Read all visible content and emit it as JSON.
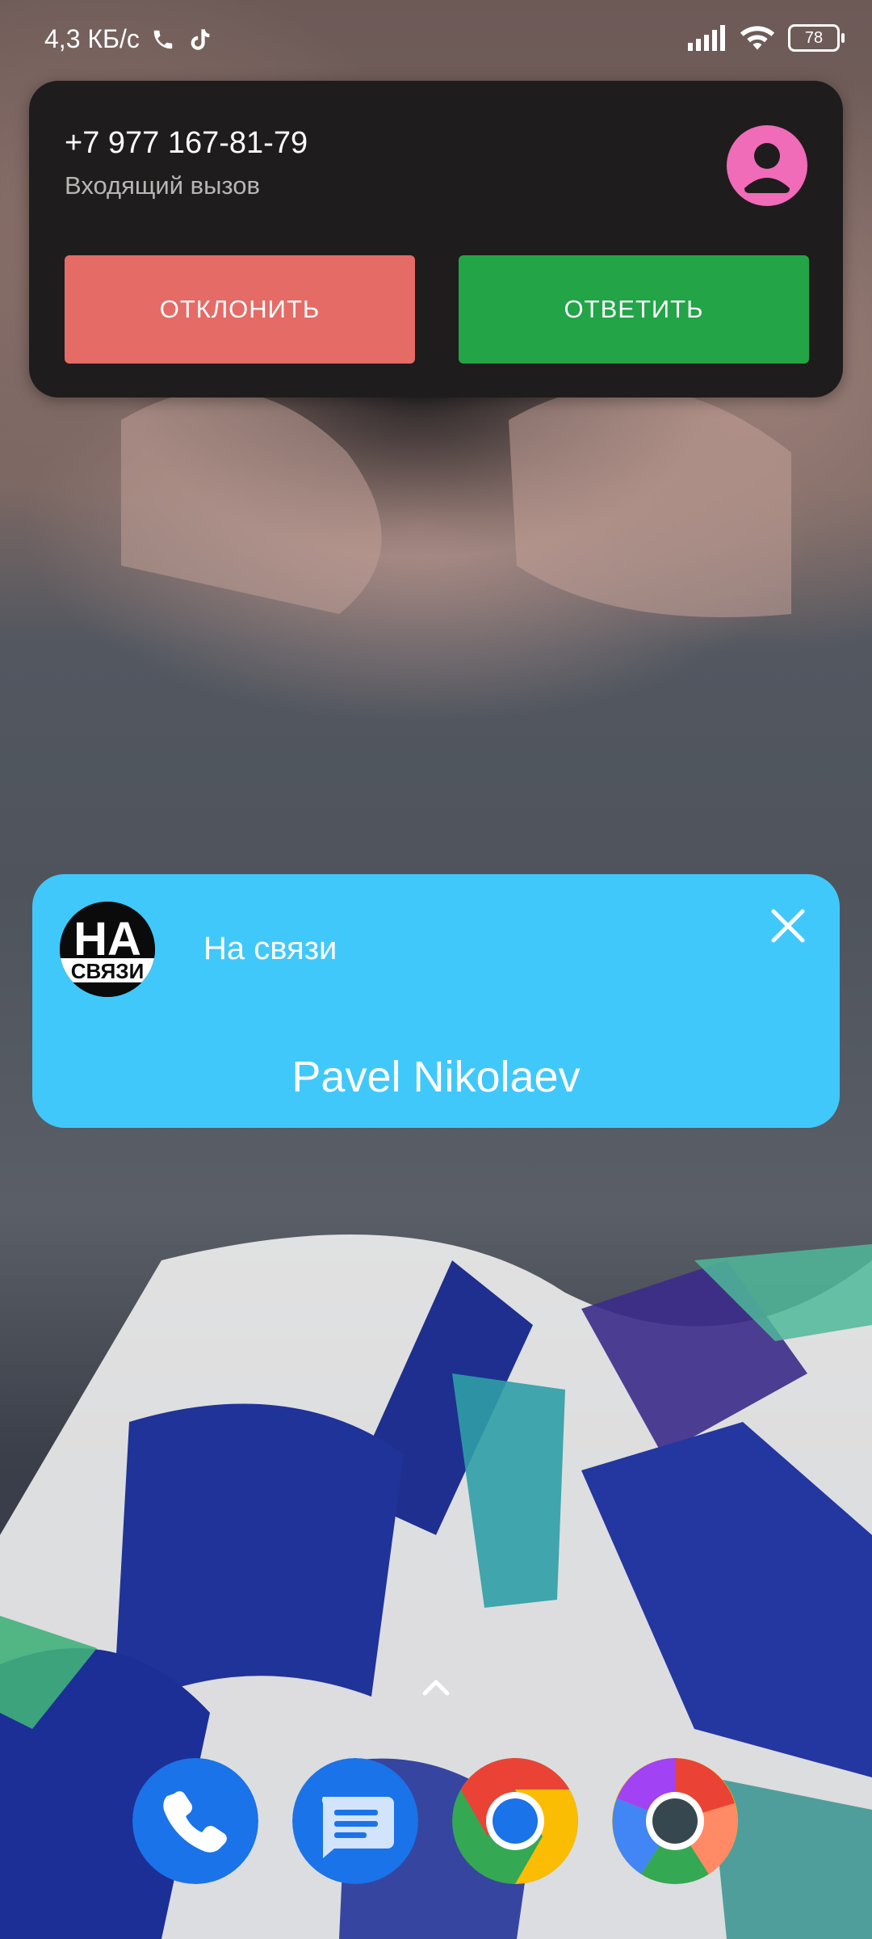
{
  "status_bar": {
    "network_speed": "4,3 КБ/с",
    "battery_level": "78",
    "icons": [
      "phone-call-icon",
      "tiktok-icon",
      "signal-icon",
      "wifi-icon",
      "battery-icon"
    ]
  },
  "incoming_call": {
    "number": "+7 977 167-81-79",
    "status": "Входящий вызов",
    "decline_label": "ОТКЛОНИТЬ",
    "answer_label": "ОТВЕТИТЬ",
    "colors": {
      "card": "#1f1c1d",
      "decline": "#e56b66",
      "answer": "#22a447",
      "avatar": "#f06bb8"
    }
  },
  "widget": {
    "logo_text": "НА СВЯЗИ",
    "title": "На связи",
    "name": "Pavel Nikolaev",
    "color": "#40c8fb"
  },
  "dock": {
    "apps": [
      "phone-app-icon",
      "messages-app-icon",
      "chrome-app-icon",
      "chrome-canary-app-icon"
    ]
  }
}
